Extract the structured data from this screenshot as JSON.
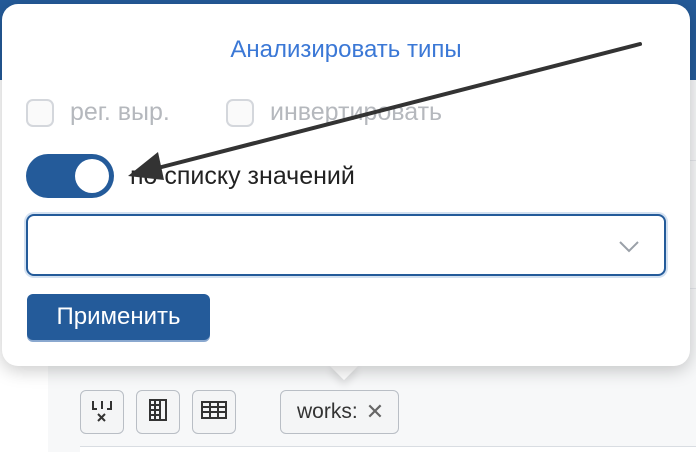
{
  "popover": {
    "analyze_link": "Анализировать типы",
    "regex_label": "рег. выр.",
    "invert_label": "инвертировать",
    "by_values_label": "по списку значений",
    "by_values_on": true,
    "select_value": "",
    "apply_label": "Применить"
  },
  "toolbar": {
    "filter_tag": "works:"
  },
  "colors": {
    "accent": "#245b9a",
    "link": "#3b78d6"
  },
  "icons": [
    "split-columns-icon",
    "columns-icon",
    "table-icon",
    "close-icon",
    "chevron-down-icon"
  ]
}
